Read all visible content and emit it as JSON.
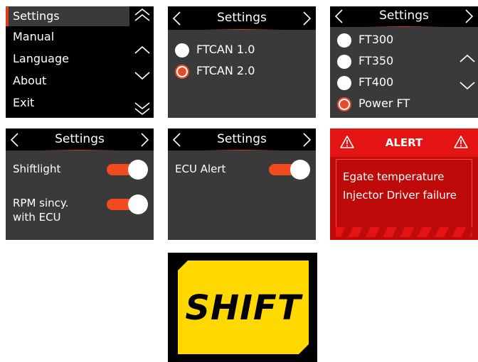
{
  "menu": {
    "items": [
      "Settings",
      "Manual",
      "Language",
      "About",
      "Exit"
    ],
    "selected_index": 0
  },
  "can_screen": {
    "title": "Settings",
    "options": [
      "FTCAN 1.0",
      "FTCAN 2.0"
    ],
    "selected_index": 1
  },
  "model_screen": {
    "title": "Settings",
    "options": [
      "FT300",
      "FT350",
      "FT400",
      "Power FT"
    ],
    "selected_index": 3
  },
  "shift_screen": {
    "title": "Settings",
    "rows": [
      {
        "label": "Shiftlight",
        "on": true
      },
      {
        "label_lines": [
          "RPM sincy.",
          "with ECU"
        ],
        "on": true
      }
    ]
  },
  "ecu_screen": {
    "title": "Settings",
    "rows": [
      {
        "label": "ECU Alert",
        "on": true
      }
    ]
  },
  "alert": {
    "title": "ALERT",
    "messages": [
      "Egate temperature",
      "Injector Driver failure"
    ]
  },
  "shift_light": {
    "label": "SHIFT"
  },
  "colors": {
    "accent": "#e8492a",
    "alert_red": "#e51414",
    "shift_yellow": "#ffd800"
  }
}
